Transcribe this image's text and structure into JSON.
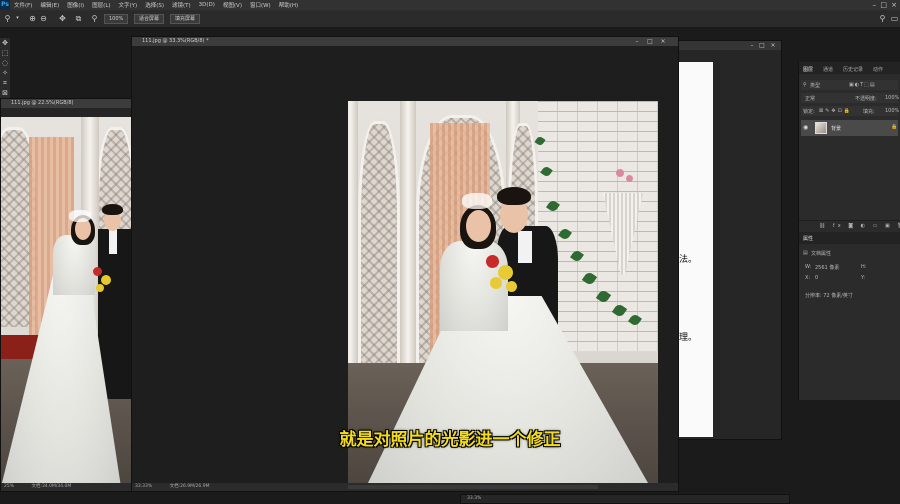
{
  "app": {
    "logo": "Ps"
  },
  "menu": [
    "文件(F)",
    "编辑(E)",
    "图像(I)",
    "图层(L)",
    "文字(Y)",
    "选择(S)",
    "滤镜(T)",
    "3D(D)",
    "视图(V)",
    "窗口(W)",
    "帮助(H)"
  ],
  "options_bar": {
    "zoom_value": "100%",
    "fit_screen_label": "适合屏幕",
    "fill_screen_label": "填充屏幕"
  },
  "windows": {
    "left": {
      "title": "111.jpg @ 22.5%(RGB/8)",
      "status": "文档:34.0M/34.0M",
      "zoom": "25%"
    },
    "main": {
      "title": "111.jpg @ 33.3%(RGB/8) *",
      "status": "文档:26.9M/26.9M",
      "zoom": "33.33%"
    },
    "behind": {
      "snippet_1": "法。",
      "snippet_2": "理。"
    },
    "bottom": {
      "zoom": "33.3%"
    }
  },
  "layers_panel": {
    "tabs": [
      "图层",
      "通道",
      "历史记录",
      "动作"
    ],
    "filter_kind": "类型",
    "blend_mode": "正常",
    "opacity_label": "不透明度:",
    "opacity": "100%",
    "lock_label": "锁定:",
    "fill_label": "填充:",
    "fill": "100%",
    "layer_name": "背景"
  },
  "properties_panel": {
    "title": "属性",
    "section": "文档属性",
    "width_label": "W:",
    "width_value": "2561 像素",
    "height_label": "H:",
    "x_label": "X:",
    "x_value": "0",
    "y_label": "Y:",
    "resolution": "分辨率: 72 像素/英寸"
  },
  "subtitle": "就是对照片的光影进一个修正"
}
